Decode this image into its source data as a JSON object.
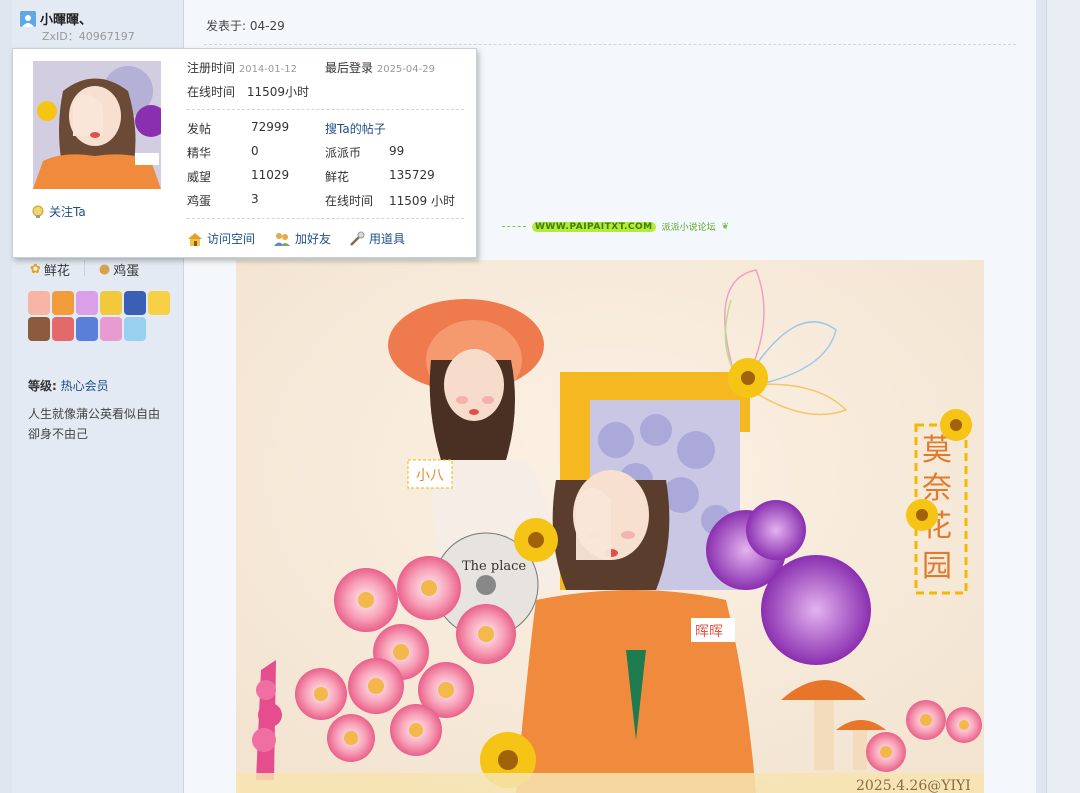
{
  "user": {
    "name": "小暉暉、",
    "zxid": "ZxID：40967197"
  },
  "post": {
    "date": "发表于: 04-29"
  },
  "popup": {
    "reg_label": "注册时间",
    "reg_date": "2014-01-12",
    "last_label": "最后登录",
    "last_date": "2025-04-29",
    "online_label": "在线时间",
    "online_value": "11509小时",
    "stats": [
      {
        "label": "发帖",
        "value": "72999"
      },
      {
        "label": "精华",
        "value": "0"
      },
      {
        "label": "威望",
        "value": "11029"
      },
      {
        "label": "鸡蛋",
        "value": "3"
      }
    ],
    "stats2": [
      {
        "label": "派派币",
        "value": "99"
      },
      {
        "label": "鲜花",
        "value": "135729"
      },
      {
        "label": "在线时间",
        "value": "11509 小时"
      }
    ],
    "search_posts": "搜Ta的帖子",
    "follow": "关注Ta",
    "actions": {
      "space": "访问空间",
      "friend": "加好友",
      "tool": "用道具"
    }
  },
  "sidebar": {
    "gift_flower": "鲜花",
    "gift_egg": "鸡蛋",
    "level_label": "等级:",
    "level_value": "热心会员",
    "signature": "人生就像蒲公英看似自由卻身不由己"
  },
  "banner": {
    "site": "WWW.PAIPAITXT.COM",
    "forum": "派派小说论坛"
  },
  "artwork": {
    "title_chars": [
      "莫",
      "奈",
      "花",
      "园"
    ],
    "tag_left": "小八",
    "tag_right": "晖晖",
    "footer": "2025.4.26@YIYI",
    "record_text": "The place"
  },
  "colors": {
    "link": "#1f4f88",
    "accent_orange": "#f08a3c",
    "accent_yellow": "#f5b800"
  }
}
